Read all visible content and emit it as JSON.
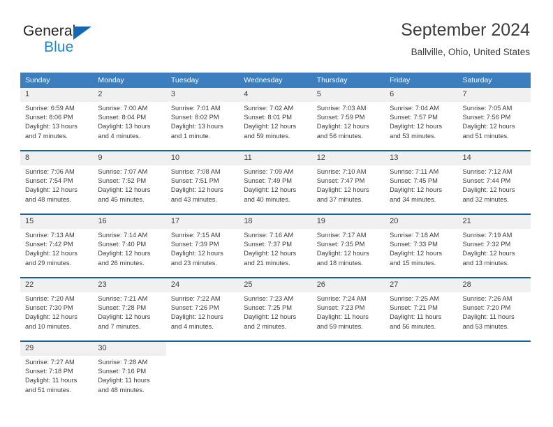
{
  "brand": {
    "name_dark": "General",
    "name_blue": "Blue",
    "accent_blue": "#1467b3",
    "light_blue": "#1a86d8"
  },
  "header": {
    "title": "September 2024",
    "location": "Ballville, Ohio, United States"
  },
  "theme": {
    "header_bg": "#3d7ebf",
    "row_divider": "#1a5fa0",
    "daynum_bg": "#f0f0f0",
    "text": "#3c3c3c"
  },
  "weekdays": [
    "Sunday",
    "Monday",
    "Tuesday",
    "Wednesday",
    "Thursday",
    "Friday",
    "Saturday"
  ],
  "labels": {
    "sunrise": "Sunrise:",
    "sunset": "Sunset:",
    "daylight": "Daylight:"
  },
  "weeks": [
    [
      {
        "day": "1",
        "sunrise": "Sunrise: 6:59 AM",
        "sunset": "Sunset: 8:06 PM",
        "daylight_1": "Daylight: 13 hours",
        "daylight_2": "and 7 minutes."
      },
      {
        "day": "2",
        "sunrise": "Sunrise: 7:00 AM",
        "sunset": "Sunset: 8:04 PM",
        "daylight_1": "Daylight: 13 hours",
        "daylight_2": "and 4 minutes."
      },
      {
        "day": "3",
        "sunrise": "Sunrise: 7:01 AM",
        "sunset": "Sunset: 8:02 PM",
        "daylight_1": "Daylight: 13 hours",
        "daylight_2": "and 1 minute."
      },
      {
        "day": "4",
        "sunrise": "Sunrise: 7:02 AM",
        "sunset": "Sunset: 8:01 PM",
        "daylight_1": "Daylight: 12 hours",
        "daylight_2": "and 59 minutes."
      },
      {
        "day": "5",
        "sunrise": "Sunrise: 7:03 AM",
        "sunset": "Sunset: 7:59 PM",
        "daylight_1": "Daylight: 12 hours",
        "daylight_2": "and 56 minutes."
      },
      {
        "day": "6",
        "sunrise": "Sunrise: 7:04 AM",
        "sunset": "Sunset: 7:57 PM",
        "daylight_1": "Daylight: 12 hours",
        "daylight_2": "and 53 minutes."
      },
      {
        "day": "7",
        "sunrise": "Sunrise: 7:05 AM",
        "sunset": "Sunset: 7:56 PM",
        "daylight_1": "Daylight: 12 hours",
        "daylight_2": "and 51 minutes."
      }
    ],
    [
      {
        "day": "8",
        "sunrise": "Sunrise: 7:06 AM",
        "sunset": "Sunset: 7:54 PM",
        "daylight_1": "Daylight: 12 hours",
        "daylight_2": "and 48 minutes."
      },
      {
        "day": "9",
        "sunrise": "Sunrise: 7:07 AM",
        "sunset": "Sunset: 7:52 PM",
        "daylight_1": "Daylight: 12 hours",
        "daylight_2": "and 45 minutes."
      },
      {
        "day": "10",
        "sunrise": "Sunrise: 7:08 AM",
        "sunset": "Sunset: 7:51 PM",
        "daylight_1": "Daylight: 12 hours",
        "daylight_2": "and 43 minutes."
      },
      {
        "day": "11",
        "sunrise": "Sunrise: 7:09 AM",
        "sunset": "Sunset: 7:49 PM",
        "daylight_1": "Daylight: 12 hours",
        "daylight_2": "and 40 minutes."
      },
      {
        "day": "12",
        "sunrise": "Sunrise: 7:10 AM",
        "sunset": "Sunset: 7:47 PM",
        "daylight_1": "Daylight: 12 hours",
        "daylight_2": "and 37 minutes."
      },
      {
        "day": "13",
        "sunrise": "Sunrise: 7:11 AM",
        "sunset": "Sunset: 7:45 PM",
        "daylight_1": "Daylight: 12 hours",
        "daylight_2": "and 34 minutes."
      },
      {
        "day": "14",
        "sunrise": "Sunrise: 7:12 AM",
        "sunset": "Sunset: 7:44 PM",
        "daylight_1": "Daylight: 12 hours",
        "daylight_2": "and 32 minutes."
      }
    ],
    [
      {
        "day": "15",
        "sunrise": "Sunrise: 7:13 AM",
        "sunset": "Sunset: 7:42 PM",
        "daylight_1": "Daylight: 12 hours",
        "daylight_2": "and 29 minutes."
      },
      {
        "day": "16",
        "sunrise": "Sunrise: 7:14 AM",
        "sunset": "Sunset: 7:40 PM",
        "daylight_1": "Daylight: 12 hours",
        "daylight_2": "and 26 minutes."
      },
      {
        "day": "17",
        "sunrise": "Sunrise: 7:15 AM",
        "sunset": "Sunset: 7:39 PM",
        "daylight_1": "Daylight: 12 hours",
        "daylight_2": "and 23 minutes."
      },
      {
        "day": "18",
        "sunrise": "Sunrise: 7:16 AM",
        "sunset": "Sunset: 7:37 PM",
        "daylight_1": "Daylight: 12 hours",
        "daylight_2": "and 21 minutes."
      },
      {
        "day": "19",
        "sunrise": "Sunrise: 7:17 AM",
        "sunset": "Sunset: 7:35 PM",
        "daylight_1": "Daylight: 12 hours",
        "daylight_2": "and 18 minutes."
      },
      {
        "day": "20",
        "sunrise": "Sunrise: 7:18 AM",
        "sunset": "Sunset: 7:33 PM",
        "daylight_1": "Daylight: 12 hours",
        "daylight_2": "and 15 minutes."
      },
      {
        "day": "21",
        "sunrise": "Sunrise: 7:19 AM",
        "sunset": "Sunset: 7:32 PM",
        "daylight_1": "Daylight: 12 hours",
        "daylight_2": "and 13 minutes."
      }
    ],
    [
      {
        "day": "22",
        "sunrise": "Sunrise: 7:20 AM",
        "sunset": "Sunset: 7:30 PM",
        "daylight_1": "Daylight: 12 hours",
        "daylight_2": "and 10 minutes."
      },
      {
        "day": "23",
        "sunrise": "Sunrise: 7:21 AM",
        "sunset": "Sunset: 7:28 PM",
        "daylight_1": "Daylight: 12 hours",
        "daylight_2": "and 7 minutes."
      },
      {
        "day": "24",
        "sunrise": "Sunrise: 7:22 AM",
        "sunset": "Sunset: 7:26 PM",
        "daylight_1": "Daylight: 12 hours",
        "daylight_2": "and 4 minutes."
      },
      {
        "day": "25",
        "sunrise": "Sunrise: 7:23 AM",
        "sunset": "Sunset: 7:25 PM",
        "daylight_1": "Daylight: 12 hours",
        "daylight_2": "and 2 minutes."
      },
      {
        "day": "26",
        "sunrise": "Sunrise: 7:24 AM",
        "sunset": "Sunset: 7:23 PM",
        "daylight_1": "Daylight: 11 hours",
        "daylight_2": "and 59 minutes."
      },
      {
        "day": "27",
        "sunrise": "Sunrise: 7:25 AM",
        "sunset": "Sunset: 7:21 PM",
        "daylight_1": "Daylight: 11 hours",
        "daylight_2": "and 56 minutes."
      },
      {
        "day": "28",
        "sunrise": "Sunrise: 7:26 AM",
        "sunset": "Sunset: 7:20 PM",
        "daylight_1": "Daylight: 11 hours",
        "daylight_2": "and 53 minutes."
      }
    ],
    [
      {
        "day": "29",
        "sunrise": "Sunrise: 7:27 AM",
        "sunset": "Sunset: 7:18 PM",
        "daylight_1": "Daylight: 11 hours",
        "daylight_2": "and 51 minutes."
      },
      {
        "day": "30",
        "sunrise": "Sunrise: 7:28 AM",
        "sunset": "Sunset: 7:16 PM",
        "daylight_1": "Daylight: 11 hours",
        "daylight_2": "and 48 minutes."
      },
      {
        "day": "",
        "sunrise": "",
        "sunset": "",
        "daylight_1": "",
        "daylight_2": ""
      },
      {
        "day": "",
        "sunrise": "",
        "sunset": "",
        "daylight_1": "",
        "daylight_2": ""
      },
      {
        "day": "",
        "sunrise": "",
        "sunset": "",
        "daylight_1": "",
        "daylight_2": ""
      },
      {
        "day": "",
        "sunrise": "",
        "sunset": "",
        "daylight_1": "",
        "daylight_2": ""
      },
      {
        "day": "",
        "sunrise": "",
        "sunset": "",
        "daylight_1": "",
        "daylight_2": ""
      }
    ]
  ]
}
